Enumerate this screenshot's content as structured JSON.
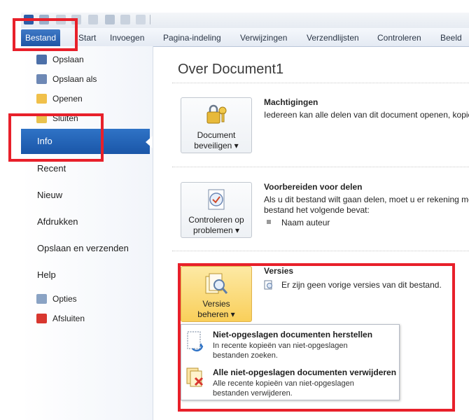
{
  "ribbon": {
    "tabs": [
      "Bestand",
      "Start",
      "Invoegen",
      "Pagina-indeling",
      "Verwijzingen",
      "Verzendlijsten",
      "Controleren",
      "Beeld"
    ]
  },
  "sidebar": {
    "small_top": [
      {
        "label": "Opslaan",
        "icon": "save-icon"
      },
      {
        "label": "Opslaan als",
        "icon": "save-as-icon"
      },
      {
        "label": "Openen",
        "icon": "open-folder-icon"
      },
      {
        "label": "Sluiten",
        "icon": "close-document-icon"
      }
    ],
    "selected": "Info",
    "big": [
      "Recent",
      "Nieuw",
      "Afdrukken",
      "Opslaan en verzenden",
      "Help"
    ],
    "small_bottom": [
      {
        "label": "Opties",
        "icon": "options-icon"
      },
      {
        "label": "Afsluiten",
        "icon": "exit-icon"
      }
    ]
  },
  "main": {
    "title": "Over Document1",
    "machtigingen": {
      "button": [
        "Document",
        "beveiligen ▾"
      ],
      "title": "Machtigingen",
      "text": "Iedereen kan alle delen van dit document openen, kopië"
    },
    "delen": {
      "button": [
        "Controleren op",
        "problemen ▾"
      ],
      "title": "Voorbereiden voor delen",
      "text1": "Als u dit bestand wilt gaan delen, moet u er rekening me",
      "text2": "bestand het volgende bevat:",
      "bullet": "Naam auteur"
    },
    "versies": {
      "button": [
        "Versies",
        "beheren ▾"
      ],
      "title": "Versies",
      "text": "Er zijn geen vorige versies van dit bestand."
    },
    "dropdown": [
      {
        "title": "Niet-opgeslagen documenten herstellen",
        "desc1": "In recente kopieën van niet-opgeslagen",
        "desc2": "bestanden zoeken."
      },
      {
        "title": "Alle niet-opgeslagen documenten verwijderen",
        "desc1": "Alle recente kopieën van niet-opgeslagen",
        "desc2": "bestanden verwijderen."
      }
    ]
  },
  "colors": {
    "accent_blue": "#1e55a5",
    "annotation_red": "#e8202a",
    "versies_yellow": "#f9cf5a"
  }
}
